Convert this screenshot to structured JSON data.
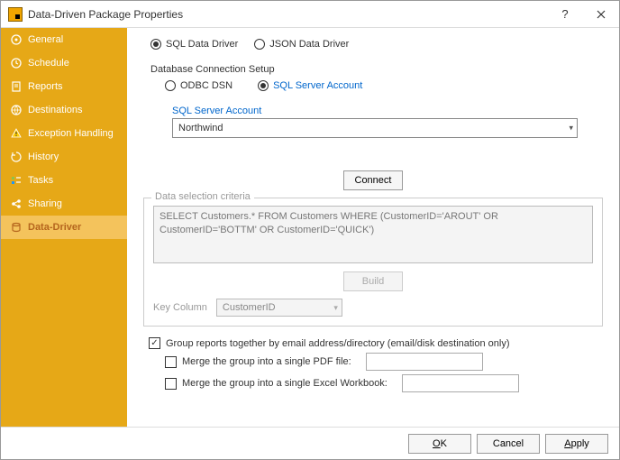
{
  "title": "Data-Driven Package Properties",
  "sidebar": {
    "items": [
      {
        "label": "General"
      },
      {
        "label": "Schedule"
      },
      {
        "label": "Reports"
      },
      {
        "label": "Destinations"
      },
      {
        "label": "Exception Handling"
      },
      {
        "label": "History"
      },
      {
        "label": "Tasks"
      },
      {
        "label": "Sharing"
      },
      {
        "label": "Data-Driver"
      }
    ]
  },
  "driver": {
    "sql": "SQL Data Driver",
    "json": "JSON Data Driver"
  },
  "conn": {
    "heading": "Database Connection Setup",
    "odbc": "ODBC DSN",
    "sqlacct": "SQL Server Account",
    "acct_label": "SQL Server Account",
    "acct_value": "Northwind",
    "connect": "Connect"
  },
  "criteria": {
    "legend": "Data selection criteria",
    "sql": "SELECT Customers.* FROM Customers WHERE (CustomerID='AROUT' OR CustomerID='BOTTM' OR CustomerID='QUICK')",
    "build": "Build",
    "keycol_label": "Key Column",
    "keycol_value": "CustomerID"
  },
  "group": {
    "together": "Group reports together by email address/directory (email/disk destination only)",
    "pdf": "Merge the group into a single PDF file:",
    "xls": "Merge the group into a single Excel Workbook:"
  },
  "footer": {
    "ok": "OK",
    "cancel": "Cancel",
    "apply": "Apply"
  }
}
